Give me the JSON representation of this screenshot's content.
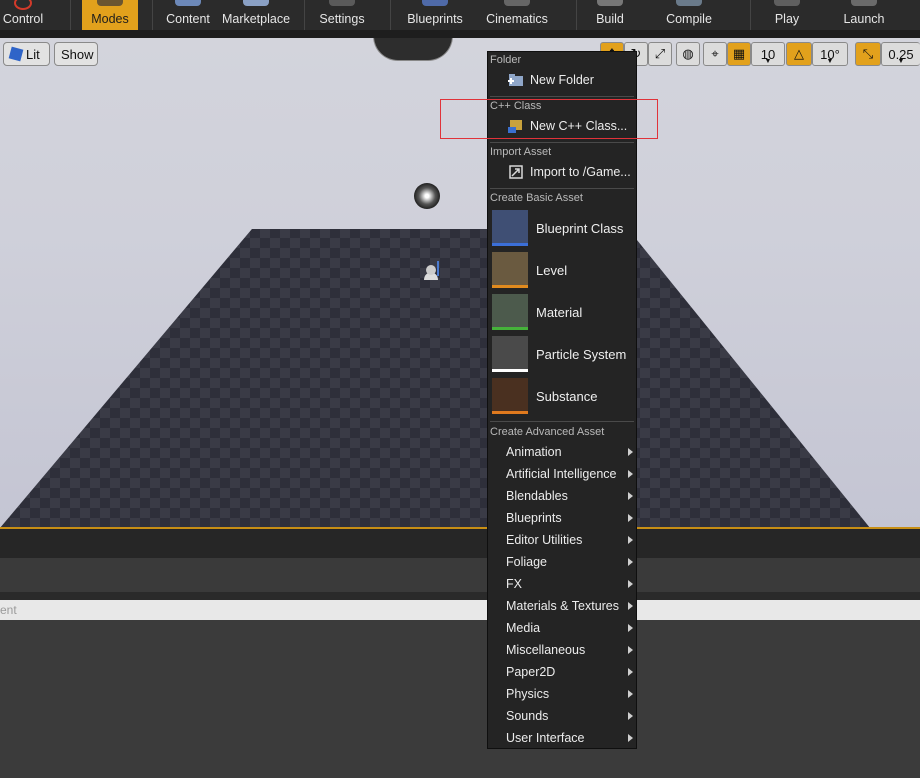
{
  "toolbar": {
    "control_label": "Control",
    "modes_label": "Modes",
    "content_label": "Content",
    "marketplace_label": "Marketplace",
    "settings_label": "Settings",
    "blueprints_label": "Blueprints",
    "cinematics_label": "Cinematics",
    "build_label": "Build",
    "compile_label": "Compile",
    "play_label": "Play",
    "launch_label": "Launch"
  },
  "viewport": {
    "lit_label": "Lit",
    "show_label": "Show",
    "grid_snap_value": "10",
    "rotation_snap_value": "10°",
    "scale_snap_value": "0.25"
  },
  "content_browser": {
    "search_text": "ent"
  },
  "menu": {
    "folder_section": "Folder",
    "new_folder": "New Folder",
    "cpp_section": "C++ Class",
    "new_cpp_class": "New C++ Class...",
    "import_section": "Import Asset",
    "import_to": "Import to /Game...",
    "basic_section": "Create Basic Asset",
    "basic_assets": [
      {
        "label": "Blueprint Class",
        "stripe_color": "#3b6fd8"
      },
      {
        "label": "Level",
        "stripe_color": "#e08a1e"
      },
      {
        "label": "Material",
        "stripe_color": "#45b23a"
      },
      {
        "label": "Particle System",
        "stripe_color": "#ffffff"
      },
      {
        "label": "Substance",
        "stripe_color": "#e07a1e"
      }
    ],
    "advanced_section": "Create Advanced Asset",
    "advanced_items": [
      "Animation",
      "Artificial Intelligence",
      "Blendables",
      "Blueprints",
      "Editor Utilities",
      "Foliage",
      "FX",
      "Materials & Textures",
      "Media",
      "Miscellaneous",
      "Paper2D",
      "Physics",
      "Sounds",
      "User Interface"
    ]
  },
  "colors": {
    "accent": "#e2a11c",
    "menu_bg": "#242424",
    "highlight": "#e0333a"
  }
}
